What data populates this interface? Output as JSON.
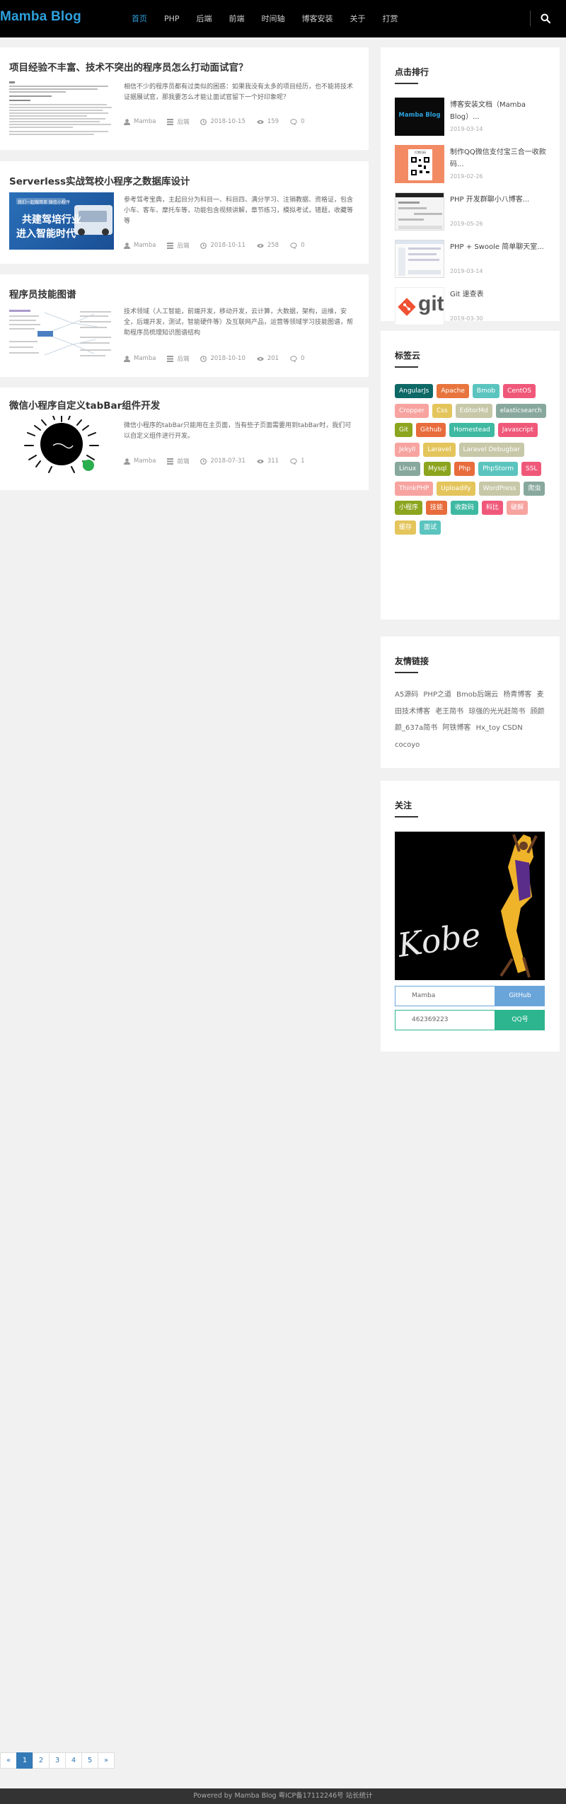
{
  "header": {
    "logo": "Mamba Blog",
    "nav": [
      "首页",
      "PHP",
      "后端",
      "前端",
      "时间轴",
      "博客安装",
      "关于",
      "打赏"
    ]
  },
  "posts": [
    {
      "title": "项目经验不丰富、技术不突出的程序员怎么打动面试官？",
      "excerpt": "相信不少的程序员都有过类似的困惑：如果我没有太多的项目经历，也不能将技术证据展试官，那我要怎么才能让面试官留下一个好印象呢？",
      "author": "Mamba",
      "category": "后端",
      "date": "2018-10-15",
      "views": "159",
      "comments": "0"
    },
    {
      "title": "Serverless实战驾校小程序之数据库设计",
      "excerpt": "参考驾考宝典，主起目分为科目一、科目四、满分学习、注销教据、资格证，包含小车、客车、摩托车等，功能包含视频讲解，章节练习，模拟考试，错题，收藏等等",
      "author": "Mamba",
      "category": "后端",
      "date": "2018-10-11",
      "views": "258",
      "comments": "0",
      "thumb_text": [
        "我们一起做简单 微信小程序",
        "共建驾培行业",
        "进入智能时代"
      ]
    },
    {
      "title": "程序员技能图谱",
      "excerpt": "技术领域（人工智能，前端开发，移动开发，云计算，大数据，架构，运维，安全，后端开发，测试，智能硬件等）及互联网产品，运营等领域学习技能图谱，帮助程序员梳理知识图谱结构",
      "author": "Mamba",
      "category": "后端",
      "date": "2018-10-10",
      "views": "201",
      "comments": "0"
    },
    {
      "title": "微信小程序自定义tabBar组件开发",
      "excerpt": "微信小程序的tabBar只能用在主页面，当有些子页面需要用到tabBar时，我们可以自定义组件进行开发。",
      "author": "Mamba",
      "category": "前端",
      "date": "2018-07-31",
      "views": "311",
      "comments": "1"
    }
  ],
  "sidebar": {
    "hot": {
      "title": "点击排行",
      "items": [
        {
          "title": "博客安装文档（Mamba Blog）...",
          "date": "2019-03-14",
          "thumb_text": "Mamba Blog"
        },
        {
          "title": "制作QQ微信支付宝三合一收款码...",
          "date": "2019-02-26",
          "thumb_text": "打赏扫码"
        },
        {
          "title": "PHP 开发群聊小八博客...",
          "date": "2019-05-26"
        },
        {
          "title": "PHP + Swoole 简单聊天室...",
          "date": "2019-03-14"
        },
        {
          "title": "Git 速查表",
          "date": "2019-03-30",
          "thumb_text": "git"
        }
      ]
    },
    "tags": {
      "title": "标签云",
      "items": [
        {
          "label": "AngularJs",
          "color": "#0d6866"
        },
        {
          "label": "Apache",
          "color": "#e8753d"
        },
        {
          "label": "Bmob",
          "color": "#5bc4be"
        },
        {
          "label": "CentOS",
          "color": "#f0587a"
        },
        {
          "label": "Cropper",
          "color": "#f7a3a0"
        },
        {
          "label": "Css",
          "color": "#e4c55c"
        },
        {
          "label": "EditorMd",
          "color": "#c6c8a8"
        },
        {
          "label": "elasticsearch",
          "color": "#88a89d"
        },
        {
          "label": "Git",
          "color": "#8ca51f"
        },
        {
          "label": "Github",
          "color": "#e86c3c"
        },
        {
          "label": "Homestead",
          "color": "#3fb9a2"
        },
        {
          "label": "Javascript",
          "color": "#f0587a"
        },
        {
          "label": "Jekyll",
          "color": "#f7a3a0"
        },
        {
          "label": "Laravel",
          "color": "#e4c55c"
        },
        {
          "label": "Laravel Debugbar",
          "color": "#c6c8a8"
        },
        {
          "label": "Linux",
          "color": "#88a89d"
        },
        {
          "label": "Mysql",
          "color": "#8ca51f"
        },
        {
          "label": "Php",
          "color": "#e86c3c"
        },
        {
          "label": "PhpStorm",
          "color": "#5bc4be"
        },
        {
          "label": "SSL",
          "color": "#f0587a"
        },
        {
          "label": "ThinkPHP",
          "color": "#f7a3a0"
        },
        {
          "label": "Uploadify",
          "color": "#e4c55c"
        },
        {
          "label": "WordPress",
          "color": "#c6c8a8"
        },
        {
          "label": "爬虫",
          "color": "#88a89d"
        },
        {
          "label": "小程序",
          "color": "#8ca51f"
        },
        {
          "label": "技能",
          "color": "#e86c3c"
        },
        {
          "label": "收款码",
          "color": "#3fb9a2"
        },
        {
          "label": "科比",
          "color": "#f0587a"
        },
        {
          "label": "破解",
          "color": "#f7a3a0"
        },
        {
          "label": "缓存",
          "color": "#e4c55c"
        },
        {
          "label": "面试",
          "color": "#5bc4be"
        }
      ]
    },
    "links": {
      "title": "友情链接",
      "items": [
        "A5源码",
        "PHP之道",
        "Bmob后端云",
        "杨青博客",
        "麦田技术博客",
        "老王简书",
        "琼强的光光赶简书",
        "顾颜颜_637a简书",
        "阿铁博客",
        "Hx_toy CSDN",
        "cocoyo"
      ]
    },
    "follow": {
      "title": "关注",
      "image_text": "Kobe",
      "rows": [
        {
          "value": "Mamba",
          "button": "GitHub",
          "color": "#6aa5da"
        },
        {
          "value": "462369223",
          "button": "QQ号",
          "color": "#2cb58e"
        }
      ]
    }
  },
  "pagination": [
    "«",
    "1",
    "2",
    "3",
    "4",
    "5",
    "»"
  ],
  "footer": "Powered by Mamba Blog 粤ICP备17112246号   站长统计"
}
